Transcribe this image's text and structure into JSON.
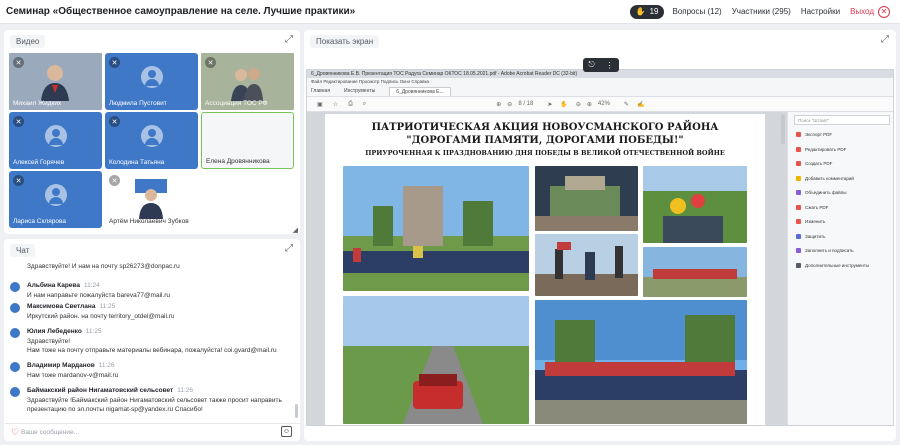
{
  "topbar": {
    "title": "Семинар «Общественное самоуправление на селе. Лучшие практики»",
    "raised_hands": "19",
    "questions": "Вопросы (12)",
    "participants": "Участники (295)",
    "settings": "Настройки",
    "exit": "Выход"
  },
  "video": {
    "header": "Видео",
    "tiles": [
      {
        "name": "Михаил Жидких",
        "type": "photo"
      },
      {
        "name": "Людмила Пустовит",
        "type": "avatar"
      },
      {
        "name": "Ассоциация ТОС РФ",
        "type": "photo"
      },
      {
        "name": "Алексей Горячев",
        "type": "avatar"
      },
      {
        "name": "Колодина Татьяна",
        "type": "avatar"
      },
      {
        "name": "Елена Дровянникова",
        "type": "empty"
      },
      {
        "name": "Лариса Склярова",
        "type": "avatar"
      },
      {
        "name": "Артём Николаевич Зубков",
        "type": "photo"
      }
    ]
  },
  "chat": {
    "header": "Чат",
    "input_placeholder": "Ваше сообщение...",
    "messages": [
      {
        "author": "",
        "time": "",
        "lines": [
          "Здравствуйте! И нам на почту sp26273@donpac.ru"
        ]
      },
      {
        "author": "Альбина Карева",
        "time": "11:24",
        "lines": [
          "И нам направьте пожалуйста bareva77@mail.ru"
        ]
      },
      {
        "author": "Максимова Светлана",
        "time": "11:25",
        "lines": [
          "Иркутский район. на почту territory_otdel@mail.ru"
        ]
      },
      {
        "author": "Юлия Лебеденко",
        "time": "11:25",
        "lines": [
          "Здравствуйте!",
          "Нам тоже на почту отправьте материалы вебинара, пожалуйста! coi.gvard@mail.ru"
        ]
      },
      {
        "author": "Владимир Марданов",
        "time": "11:26",
        "lines": [
          "Нам тоже mardanov-v@mail.ru"
        ]
      },
      {
        "author": "Баймакский район Нигаматовский сельсовет",
        "time": "11:26",
        "lines": [
          "Здравствуйте !Баймакский район Нигаматовский сельсовет также просит направить",
          "презентацию по эл.почты nigamat-sp@yandex.ru Спасибо!"
        ]
      }
    ]
  },
  "screen": {
    "header": "Показать экран",
    "acrobat": {
      "window_title": "6_Дровянникова Е.В. Презентация ТОС Радуга Семинар ОКТОС 18.05.2021.pdf - Adobe Acrobat Reader DC (32-bit)",
      "menu": "Файл  Редактирование  Просмотр  Подпись  Окно  Справка",
      "tabs": [
        "Главная",
        "Инструменты"
      ],
      "doc_tab": "6_Дровянникова Е...",
      "page_indicator": "8 / 18",
      "zoom": "42%",
      "find_placeholder": "Поиск \"Штамп\"",
      "tools": [
        {
          "label": "Экспорт PDF",
          "color": "#e8534a"
        },
        {
          "label": "Редактировать PDF",
          "color": "#e8534a"
        },
        {
          "label": "Создать PDF",
          "color": "#e8534a"
        },
        {
          "label": "Добавить комментарий",
          "color": "#f0b400"
        },
        {
          "label": "Объединить файлы",
          "color": "#8a5cd6"
        },
        {
          "label": "Сжать PDF",
          "color": "#e8534a"
        },
        {
          "label": "Изменить",
          "color": "#e8534a"
        },
        {
          "label": "Защитить",
          "color": "#5b6bd6"
        },
        {
          "label": "Заполнить и подписать",
          "color": "#8a5cd6"
        },
        {
          "label": "Дополнительные инструменты",
          "color": "#555b66"
        }
      ]
    },
    "slide": {
      "title_line1": "ПАТРИОТИЧЕСКАЯ АКЦИЯ НОВОУСМАНСКОГО РАЙОНА",
      "title_line2": "\"ДОРОГАМИ ПАМЯТИ, ДОРОГАМИ ПОБЕДЫ!\"",
      "subtitle": "ПРИУРОЧЕННАЯ К ПРАЗДНОВАНИЮ ДНЯ ПОБЕДЫ В ВЕЛИКОЙ ОТЕЧЕСТВЕННОЙ ВОЙНЕ"
    }
  },
  "colors": {
    "tile_blue": "#3f78c7",
    "exit_red": "#e0324a",
    "active_speaker": "#7ac35a"
  }
}
